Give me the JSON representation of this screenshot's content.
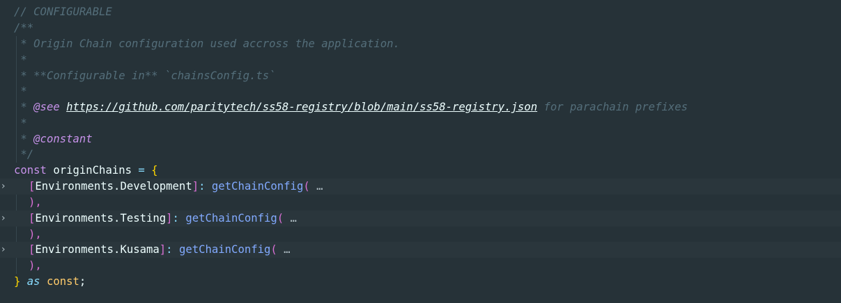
{
  "editor": {
    "lines": {
      "l1": "// CONFIGURABLE",
      "l2": "/**",
      "l3": " * Origin Chain configuration used accross the application.",
      "l4": " *",
      "l5": " * **Configurable in** `chainsConfig.ts`",
      "l6": " *",
      "l7_prefix": " * ",
      "l7_tag": "@see",
      "l7_url": "https://github.com/paritytech/ss58-registry/blob/main/ss58-registry.json",
      "l7_suffix": " for parachain prefixes",
      "l8": " *",
      "l9_prefix": " * ",
      "l9_tag": "@constant",
      "l10": " */",
      "l11_const": "const",
      "l11_name": " originChains ",
      "l11_eq": "=",
      "l11_brace": " {",
      "entries": [
        {
          "open": "[",
          "key": "Environments.Development",
          "close": "]",
          "colon": ": ",
          "fn": "getChainConfig",
          "paren": "(",
          "dots": " …",
          "end": "),"
        },
        {
          "open": "[",
          "key": "Environments.Testing",
          "close": "]",
          "colon": ": ",
          "fn": "getChainConfig",
          "paren": "(",
          "dots": " …",
          "end": "),"
        },
        {
          "open": "[",
          "key": "Environments.Kusama",
          "close": "]",
          "colon": ": ",
          "fn": "getChainConfig",
          "paren": "(",
          "dots": " …",
          "end": "),"
        }
      ],
      "last_brace": "}",
      "last_as": " as ",
      "last_const": "const",
      "last_semi": ";"
    },
    "fold_icon": "chevron-right-icon",
    "fold_glyph": "›"
  }
}
